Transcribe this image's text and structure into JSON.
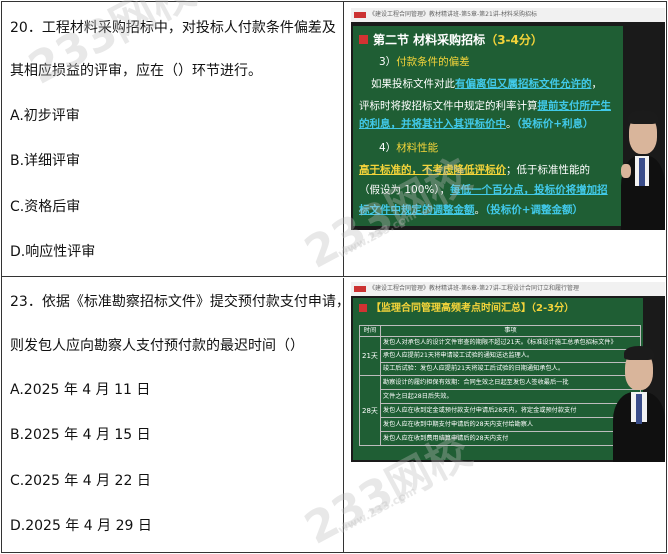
{
  "questions": [
    {
      "lines": [
        "20．工程材料采购招标中，对投标人付款条件偏差及",
        "其相应损益的评审，应在（）环节进行。"
      ],
      "options": [
        "A.初步评审",
        "B.详细评审",
        "C.资格后审",
        "D.响应性评审"
      ]
    },
    {
      "lines": [
        "23．依据《标准勘察招标文件》提交预付款支付申请，",
        "则发包人应向勘察人支付预付款的最迟时间（）"
      ],
      "options": [
        "A.2025 年 4 月 11 日",
        "B.2025 年 4 月 15 日",
        "C.2025 年 4 月 22 日",
        "D.2025 年 4 月 29 日"
      ]
    }
  ],
  "slide1": {
    "bar": "《建设工程合同管理》教材精讲班-第5章-第21讲-材料采购招标",
    "title_main": "第二节  材料采购招标",
    "title_range": "（3-4分）",
    "lines": [
      {
        "segments": [
          {
            "t": "3）",
            "c": "w"
          },
          {
            "t": "付款条件的偏差",
            "c": "y"
          }
        ]
      },
      {
        "segments": [
          {
            "t": "如果投标文件对此",
            "c": "w"
          },
          {
            "t": "有偏离但又属招标文件允许的",
            "c": "cu"
          },
          {
            "t": "，",
            "c": "w"
          }
        ]
      },
      {
        "segments": [
          {
            "t": "评标时将按招标文件中规定的利率计算",
            "c": "w"
          },
          {
            "t": "提前支付所产生",
            "c": "cu"
          }
        ]
      },
      {
        "segments": [
          {
            "t": "的利息，并将其计入其评标价中",
            "c": "cu"
          },
          {
            "t": "。",
            "c": "w"
          },
          {
            "t": "（投标价+利息）",
            "c": "c"
          }
        ]
      },
      {
        "segments": [
          {
            "t": "4）",
            "c": "w"
          },
          {
            "t": "材料性能",
            "c": "y"
          }
        ]
      },
      {
        "segments": [
          {
            "t": "高于标准的，不考虑降低评标价",
            "c": "yu"
          },
          {
            "t": "；低于标准性能的",
            "c": "w"
          }
        ]
      },
      {
        "segments": [
          {
            "t": "（假设为 100%），",
            "c": "w"
          },
          {
            "t": "每低一个百分点，投标价将增加招",
            "c": "cu"
          }
        ]
      },
      {
        "segments": [
          {
            "t": "标文件中规定的调整金额",
            "c": "cu"
          },
          {
            "t": "。",
            "c": "w"
          },
          {
            "t": "（投标价+调整金额）",
            "c": "c"
          }
        ]
      }
    ]
  },
  "slide2": {
    "bar": "《建设工程合同管理》教材精讲班-第6章-第27讲-工程设计合同订立和履行管理",
    "title": "【监理合同管理高频考点时间汇总】",
    "title_range": "（2-3分）",
    "header": [
      "时间",
      "事项"
    ],
    "groups": [
      {
        "label": "21天",
        "rows": [
          "发包人对承包人的设计文件审查的期限不超过21天。《标准设计施工总承包招标文件》",
          "承包人应提前21天将申请竣工试验的通知送达监理人。",
          "竣工后试验：发包人应提前21天将竣工后试验的日期通知承包人。"
        ]
      },
      {
        "label": "28天",
        "rows": [
          "勘察设计的履约担保有效期：合同生效之日起至发包人签收最后一批",
          "文件之日起28日后失效。",
          "发包人应在收到定金或预付款支付申请后28天内，将定金或预付款支付",
          "发包人应在收到中期支付申请后的28天内支付给勘察人",
          "发包人应在收到费用结算申请后的28天内支付"
        ]
      }
    ]
  },
  "watermark": {
    "text": "233网校",
    "sub": "www.233.com"
  }
}
